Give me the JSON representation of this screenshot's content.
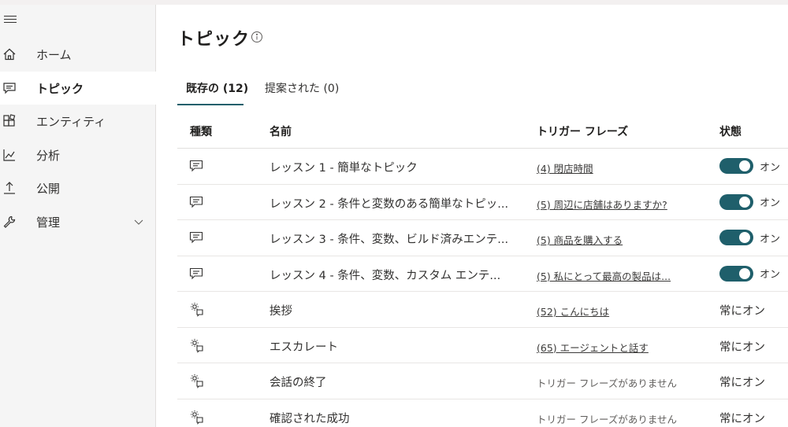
{
  "sidebar": {
    "items": [
      {
        "label": "ホーム",
        "icon": "home-icon"
      },
      {
        "label": "トピック",
        "icon": "chat-icon",
        "active": true
      },
      {
        "label": "エンティティ",
        "icon": "entities-icon"
      },
      {
        "label": "分析",
        "icon": "analytics-icon"
      },
      {
        "label": "公開",
        "icon": "publish-icon"
      },
      {
        "label": "管理",
        "icon": "wrench-icon",
        "expandable": true
      }
    ]
  },
  "main": {
    "title": "トピック",
    "tabs": [
      {
        "label": "既存の (12)",
        "active": true
      },
      {
        "label": "提案された (0)"
      }
    ],
    "columns": {
      "type": "種類",
      "name": "名前",
      "trigger": "トリガー フレーズ",
      "status": "状態"
    },
    "rows": [
      {
        "type": "chat-icon",
        "name": "レッスン 1 - 簡単なトピック",
        "trigger": "(4) 閉店時間",
        "trigger_link": true,
        "status": "オン",
        "toggle": true
      },
      {
        "type": "chat-icon",
        "name": "レッスン 2 - 条件と変数のある簡単なトピッ...",
        "trigger": "(5) 周辺に店舗はありますか?",
        "trigger_link": true,
        "status": "オン",
        "toggle": true
      },
      {
        "type": "chat-icon",
        "name": "レッスン 3 - 条件、変数、ビルド済みエンテ...",
        "trigger": "(5) 商品を購入する",
        "trigger_link": true,
        "status": "オン",
        "toggle": true
      },
      {
        "type": "chat-icon",
        "name": "レッスン 4 - 条件、変数、カスタム エンテ...",
        "trigger": "(5) 私にとって最高の製品は...",
        "trigger_link": true,
        "status": "オン",
        "toggle": true
      },
      {
        "type": "system-topic-icon",
        "name": "挨拶",
        "trigger": "(52) こんにちは",
        "trigger_link": true,
        "status": "常にオン",
        "toggle": false
      },
      {
        "type": "system-topic-icon",
        "name": "エスカレート",
        "trigger": "(65) エージェントと話す",
        "trigger_link": true,
        "status": "常にオン",
        "toggle": false
      },
      {
        "type": "system-topic-icon",
        "name": "会話の終了",
        "trigger": "トリガー フレーズがありません",
        "trigger_link": false,
        "status": "常にオン",
        "toggle": false
      },
      {
        "type": "system-topic-icon",
        "name": "確認された成功",
        "trigger": "トリガー フレーズがありません",
        "trigger_link": false,
        "status": "常にオン",
        "toggle": false
      }
    ]
  },
  "colors": {
    "accent": "#1f5f6b",
    "sidebar_bg": "#f5f5f5",
    "text": "#323130"
  }
}
